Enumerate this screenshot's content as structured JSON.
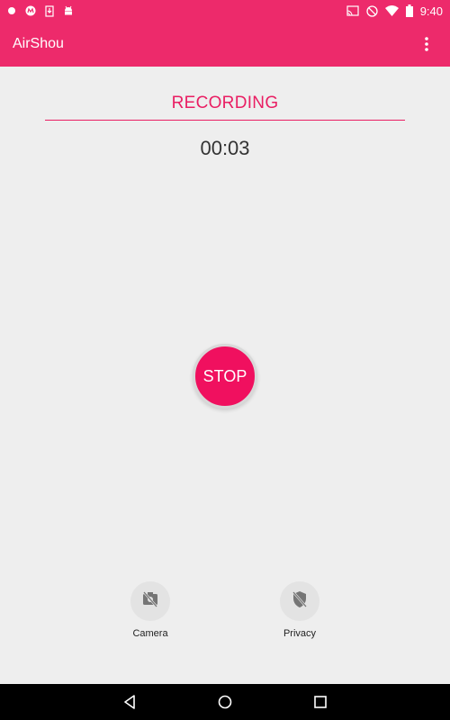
{
  "status_bar": {
    "time": "9:40",
    "icons": [
      "dot-icon",
      "metro-icon",
      "download-icon",
      "android-icon",
      "cast-icon",
      "do-not-disturb-icon",
      "wifi-icon",
      "battery-icon"
    ]
  },
  "app_bar": {
    "title": "AirShou",
    "menu_icon": "overflow-menu-icon"
  },
  "recording": {
    "status": "RECORDING",
    "timer": "00:03",
    "stop_label": "STOP"
  },
  "actions": {
    "camera_label": "Camera",
    "camera_icon": "camera-off-icon",
    "privacy_label": "Privacy",
    "privacy_icon": "privacy-off-icon"
  },
  "navigation": {
    "icons": [
      "back-icon",
      "home-icon",
      "recents-icon"
    ]
  },
  "colors": {
    "accent": "#ed2a6b",
    "stop": "#f0105f",
    "background": "#eeeeee"
  }
}
